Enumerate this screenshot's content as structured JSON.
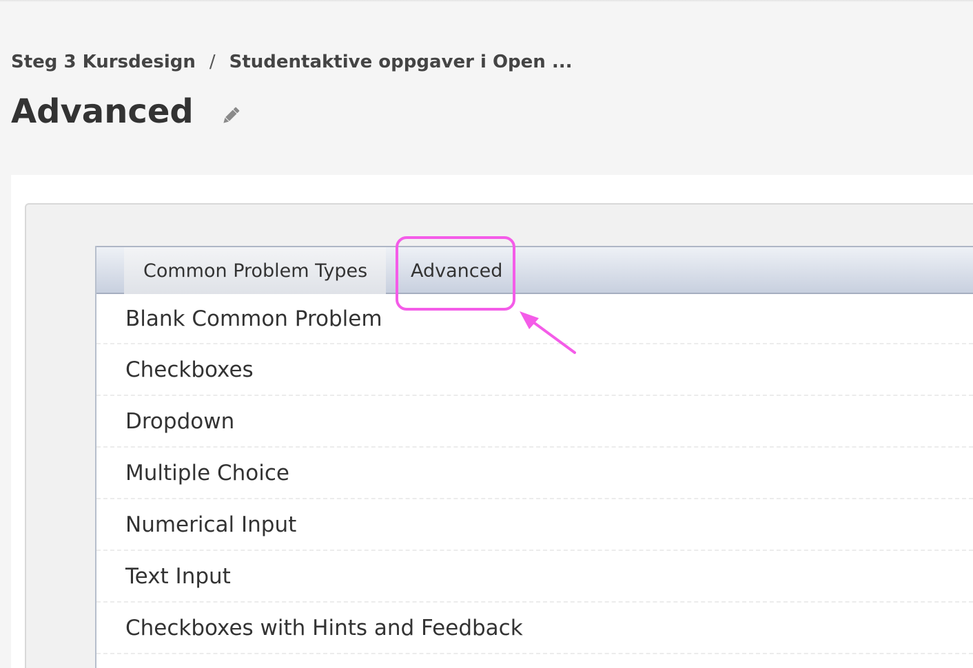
{
  "breadcrumb": {
    "parent": "Steg 3 Kursdesign",
    "separator": "/",
    "current": "Studentaktive oppgaver i Open ..."
  },
  "page": {
    "title": "Advanced",
    "edit_icon": "pencil-icon"
  },
  "tabs": [
    {
      "label": "Common Problem Types",
      "active": false
    },
    {
      "label": "Advanced",
      "active": true
    }
  ],
  "problems": [
    "Blank Common Problem",
    "Checkboxes",
    "Dropdown",
    "Multiple Choice",
    "Numerical Input",
    "Text Input",
    "Checkboxes with Hints and Feedback"
  ],
  "annotation": {
    "color": "#f45ce8",
    "type": "highlight-box-with-arrow"
  }
}
